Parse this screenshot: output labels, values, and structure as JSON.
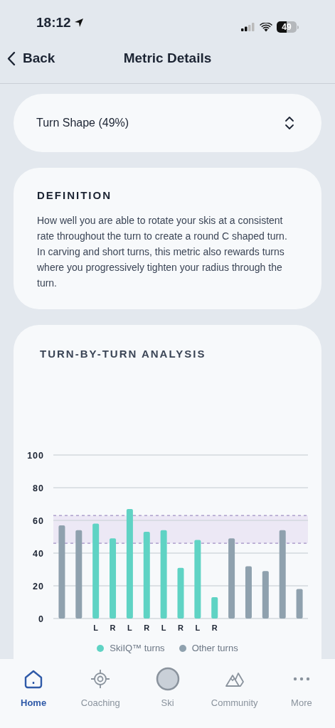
{
  "status_bar": {
    "time": "18:12",
    "battery": "49"
  },
  "nav": {
    "back": "Back",
    "title": "Metric Details"
  },
  "metric_picker": {
    "value": "Turn Shape (49%)"
  },
  "definition": {
    "heading": "DEFINITION",
    "text": "How well you are able to rotate your skis at a consistent rate throughout the turn to create a round C shaped turn. In carving and short turns, this metric also rewards turns where you progressively tighten your radius through the turn."
  },
  "analysis": {
    "heading": "TURN-BY-TURN ANALYSIS",
    "chart_data": {
      "type": "bar",
      "categories": [
        null,
        null,
        "L",
        "R",
        "L",
        "R",
        "L",
        "R",
        "L",
        "R",
        null,
        null,
        null,
        null,
        null
      ],
      "series": [
        {
          "name": "SkiIQ™ turns",
          "color": "#5fd3c4",
          "values": [
            null,
            null,
            58,
            49,
            67,
            53,
            54,
            31,
            48,
            13,
            null,
            null,
            null,
            null,
            null
          ]
        },
        {
          "name": "Other turns",
          "color": "#8fa1ae",
          "values": [
            57,
            54,
            null,
            null,
            null,
            null,
            null,
            null,
            null,
            null,
            49,
            32,
            29,
            54,
            18
          ]
        }
      ],
      "ylim": [
        0,
        100
      ],
      "yticks": [
        0,
        20,
        40,
        60,
        80,
        100
      ],
      "stacked": true,
      "grid": true,
      "bands": [
        {
          "axis": "y",
          "from": 46,
          "to": 63
        }
      ],
      "ref_lines": [
        {
          "axis": "y",
          "value": 46
        },
        {
          "axis": "y",
          "value": 63
        }
      ]
    }
  },
  "tabs": [
    {
      "label": "Home",
      "kind": "home",
      "selected": true
    },
    {
      "label": "Coaching",
      "kind": "target",
      "selected": false
    },
    {
      "label": "Ski",
      "kind": "circle",
      "selected": false
    },
    {
      "label": "Community",
      "kind": "mountains",
      "selected": false
    },
    {
      "label": "More",
      "kind": "dots",
      "selected": false
    }
  ]
}
